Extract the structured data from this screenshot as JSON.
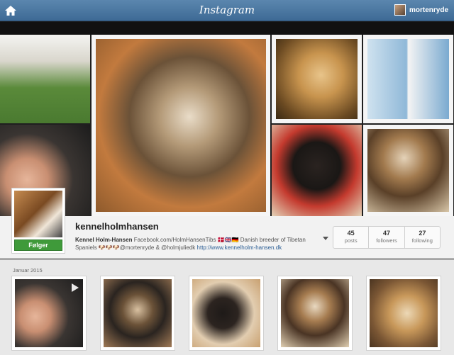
{
  "header": {
    "brand": "Instagram",
    "username": "mortenryde"
  },
  "profile": {
    "username": "kennelholmhansen",
    "follow_label": "Følger",
    "bio_name": "Kennel Holm-Hansen",
    "bio_text": " Facebook.com/HolmHansenTibs 🇩🇰🇬🇧🇩🇪 Danish breeder of Tibetan Spaniels 🐶🐶🐶@mortenryde & @holmjuliedk ",
    "bio_link": "http://www.kennelholm-hansen.dk",
    "stats": [
      {
        "value": "45",
        "label": "posts"
      },
      {
        "value": "47",
        "label": "followers"
      },
      {
        "value": "27",
        "label": "following"
      }
    ]
  },
  "feed": {
    "month_label": "Januar 2015"
  },
  "icons": {
    "home": "home-icon",
    "dropdown": "chevron-down-icon",
    "video": "play-icon"
  },
  "colors": {
    "topbar": "#4a76a0",
    "follow_button": "#3f9a3a",
    "link": "#2d5f95"
  }
}
